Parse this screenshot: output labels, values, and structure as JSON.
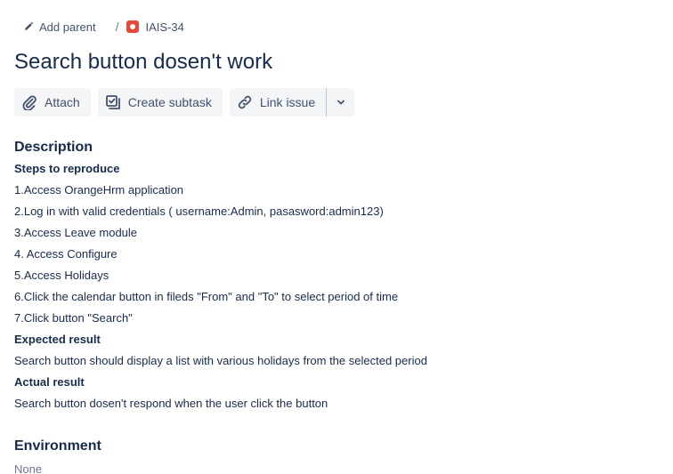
{
  "breadcrumb": {
    "add_parent": "Add parent",
    "separator": "/",
    "issue_key": "IAIS-34"
  },
  "issue": {
    "title": "Search button dosen't work"
  },
  "toolbar": {
    "attach": "Attach",
    "create_subtask": "Create subtask",
    "link_issue": "Link issue"
  },
  "description": {
    "heading": "Description",
    "lines": [
      {
        "text": "Steps to reproduce",
        "bold": true
      },
      {
        "text": "1.Access OrangeHrm application",
        "bold": false
      },
      {
        "text": "2.Log in with valid credentials ( username:Admin, pasasword:admin123)",
        "bold": false
      },
      {
        "text": "3.Access Leave module",
        "bold": false
      },
      {
        "text": "4. Access Configure",
        "bold": false
      },
      {
        "text": "5.Access Holidays",
        "bold": false
      },
      {
        "text": "6.Click the calendar button in fileds \"From\" and \"To\" to select period of time",
        "bold": false
      },
      {
        "text": "7.Click button \"Search\"",
        "bold": false
      },
      {
        "text": "Expected result",
        "bold": true
      },
      {
        "text": "Search button should display a list with various holidays from the selected period",
        "bold": false
      },
      {
        "text": "Actual result",
        "bold": true
      },
      {
        "text": "Search button dosen't respond when the user click the button",
        "bold": false
      }
    ]
  },
  "environment": {
    "heading": "Environment",
    "value": "None"
  },
  "colors": {
    "text": "#172b4d",
    "muted": "#6b778c",
    "button_bg": "#f4f5f7",
    "bug_icon": "#e5493a"
  },
  "icons": {
    "add_parent": "pencil-icon",
    "issue_type": "bug-icon",
    "attach": "paperclip-icon",
    "create_subtask": "subtask-icon",
    "link_issue": "link-icon",
    "dropdown": "chevron-down-icon"
  }
}
